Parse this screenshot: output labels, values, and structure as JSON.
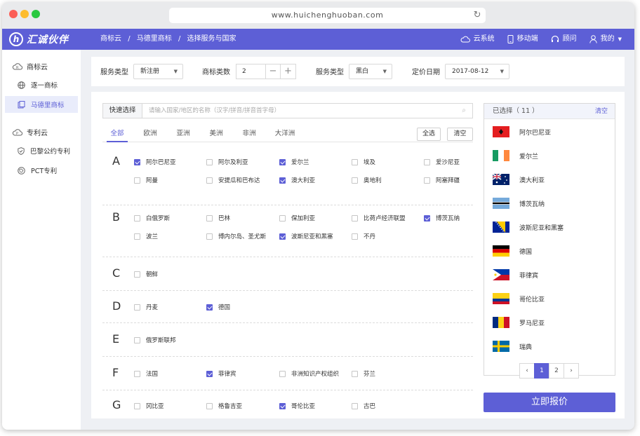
{
  "browser": {
    "url": "www.huichenghuoban.com"
  },
  "brand": {
    "logo_glyph": "h",
    "name": "汇诚伙伴",
    "accent": "#5d5fd6"
  },
  "breadcrumb": [
    "商标云",
    "/",
    "马德里商标",
    "/",
    "选择服务与国家"
  ],
  "topnav": [
    {
      "icon": "cloud-icon",
      "label": "云系统"
    },
    {
      "icon": "mobile-icon",
      "label": "移动端"
    },
    {
      "icon": "headset-icon",
      "label": "顾问"
    },
    {
      "icon": "user-icon",
      "label": "我的"
    }
  ],
  "sidebar": {
    "groups": [
      {
        "title": "商标云",
        "items": [
          {
            "label": "逐一商标",
            "active": false
          },
          {
            "label": "马德里商标",
            "active": true
          }
        ]
      },
      {
        "title": "专利云",
        "items": [
          {
            "label": "巴黎公约专利",
            "active": false
          },
          {
            "label": "PCT专利",
            "active": false
          }
        ]
      }
    ]
  },
  "filters": {
    "service_type_label": "服务类型",
    "service_type_value": "新注册",
    "class_count_label": "商标类数",
    "class_count_value": "2",
    "service_type2_label": "服务类型",
    "service_type2_value": "黑白",
    "price_date_label": "定价日期",
    "price_date_value": "2017-08-12"
  },
  "quick_select": {
    "label": "快速选择",
    "placeholder": "请输入国家/地区的名称（汉字/拼音/拼音首字母）"
  },
  "tabs": [
    "全部",
    "欧洲",
    "亚洲",
    "美洲",
    "非洲",
    "大洋洲"
  ],
  "buttons": {
    "select_all": "全选",
    "clear": "清空"
  },
  "sections": [
    {
      "letter": "A",
      "rows": [
        [
          {
            "name": "阿尔巴尼亚",
            "checked": true
          },
          {
            "name": "阿尔及利亚",
            "checked": false
          },
          {
            "name": "爱尔兰",
            "checked": true
          },
          {
            "name": "埃及",
            "checked": false
          },
          {
            "name": "爱沙尼亚",
            "checked": false
          }
        ],
        [
          {
            "name": "阿曼",
            "checked": false
          },
          {
            "name": "安提瓜和巴布达",
            "checked": false
          },
          {
            "name": "澳大利亚",
            "checked": true
          },
          {
            "name": "奥地利",
            "checked": false
          },
          {
            "name": "阿塞拜疆",
            "checked": false
          }
        ]
      ]
    },
    {
      "letter": "B",
      "rows": [
        [
          {
            "name": "白俄罗斯",
            "checked": false
          },
          {
            "name": "巴林",
            "checked": false
          },
          {
            "name": "保加利亚",
            "checked": false
          },
          {
            "name": "比荷卢经济联盟",
            "checked": false
          },
          {
            "name": "博茨瓦纳",
            "checked": true
          }
        ],
        [
          {
            "name": "波兰",
            "checked": false
          },
          {
            "name": "博内尔岛、圣尤斯",
            "checked": false
          },
          {
            "name": "波斯尼亚和黑塞",
            "checked": true
          },
          {
            "name": "不丹",
            "checked": false
          }
        ]
      ]
    },
    {
      "letter": "C",
      "rows": [
        [
          {
            "name": "朝鲜",
            "checked": false
          }
        ]
      ]
    },
    {
      "letter": "D",
      "rows": [
        [
          {
            "name": "丹麦",
            "checked": false
          },
          {
            "name": "德国",
            "checked": true
          }
        ]
      ]
    },
    {
      "letter": "E",
      "rows": [
        [
          {
            "name": "俄罗斯联邦",
            "checked": false
          }
        ]
      ]
    },
    {
      "letter": "F",
      "rows": [
        [
          {
            "name": "法国",
            "checked": false
          },
          {
            "name": "菲律宾",
            "checked": true
          },
          {
            "name": "非洲知识产权组织",
            "checked": false
          },
          {
            "name": "芬兰",
            "checked": false
          }
        ]
      ]
    },
    {
      "letter": "G",
      "rows": [
        [
          {
            "name": "冈比亚",
            "checked": false
          },
          {
            "name": "格鲁吉亚",
            "checked": false
          },
          {
            "name": "哥伦比亚",
            "checked": true
          },
          {
            "name": "古巴",
            "checked": false
          }
        ]
      ]
    }
  ],
  "selected": {
    "title": "已选择（ 11 ）",
    "clear": "清空",
    "items": [
      {
        "name": "阿尔巴尼亚",
        "flag": "albania-flag"
      },
      {
        "name": "爱尔兰",
        "flag": "ireland-flag"
      },
      {
        "name": "澳大利亚",
        "flag": "australia-flag"
      },
      {
        "name": "博茨瓦纳",
        "flag": "botswana-flag"
      },
      {
        "name": "波斯尼亚和黑塞",
        "flag": "bosnia-flag"
      },
      {
        "name": "德国",
        "flag": "germany-flag"
      },
      {
        "name": "菲律宾",
        "flag": "philippines-flag"
      },
      {
        "name": "哥伦比亚",
        "flag": "colombia-flag"
      },
      {
        "name": "罗马尼亚",
        "flag": "romania-flag"
      },
      {
        "name": "瑞典",
        "flag": "sweden-flag"
      }
    ],
    "pages": [
      "1",
      "2"
    ],
    "current_page": 1
  },
  "quote_button": "立即报价"
}
